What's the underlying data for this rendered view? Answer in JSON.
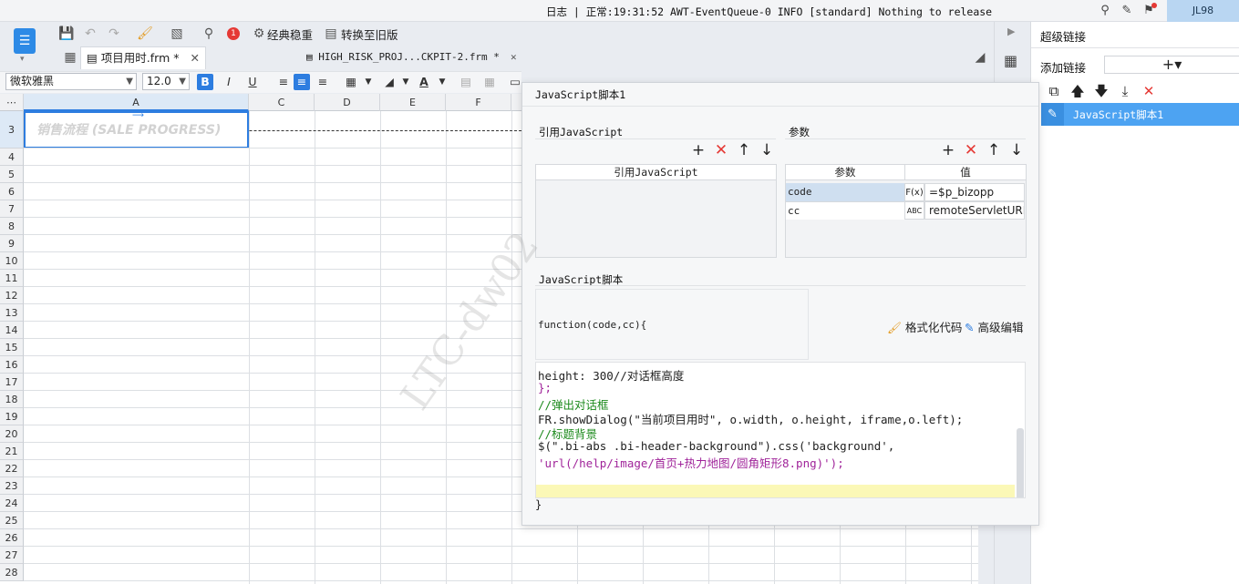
{
  "status_bar": {
    "log_text": "日志 | 正常:19:31:52 AWT-EventQueue-0 INFO [standard] Nothing to release",
    "user": "JL98"
  },
  "toolbar": {
    "notification_count": "1",
    "classic_stable_label": "经典稳重",
    "convert_old_label": "转换至旧版"
  },
  "tabs": [
    {
      "label": "项目用时.frm *",
      "active": true
    },
    {
      "label": "HIGH_RISK_PROJ...CKPIT-2.frm *",
      "active": false
    }
  ],
  "format": {
    "font_name": "微软雅黑",
    "font_size": "12.0",
    "bold": "B",
    "italic": "I",
    "underline": "U",
    "text_color": "A"
  },
  "grid": {
    "columns": [
      "A",
      "C",
      "D",
      "E",
      "F"
    ],
    "selected_row": "3",
    "rows": [
      "3",
      "4",
      "5",
      "6",
      "7",
      "8",
      "9",
      "10",
      "11",
      "12",
      "13",
      "14",
      "15",
      "16",
      "17",
      "18",
      "19",
      "20",
      "21",
      "22",
      "23",
      "24",
      "25",
      "26",
      "27",
      "28"
    ],
    "cell_a3": "销售流程 (SALE PROGRESS)"
  },
  "right_panel": {
    "title": "超级链接",
    "add_link_label": "添加链接",
    "add_button": "+▾",
    "items": [
      "JavaScript脚本1"
    ]
  },
  "dialog": {
    "title": "JavaScript脚本1",
    "ref_js_section": "引用JavaScript",
    "ref_js_column": "引用JavaScript",
    "params_section": "参数",
    "param_col": "参数",
    "value_col": "值",
    "params": [
      {
        "name": "code",
        "type_icon": "F(x)",
        "value": "=$p_bizopp"
      },
      {
        "name": "cc",
        "type_icon": "ABC",
        "value": "remoteServletURL"
      }
    ],
    "script_section": "JavaScript脚本",
    "function_sig": "function(code,cc){",
    "format_code": "格式化代码",
    "advanced_edit": "高级编辑",
    "code_lines": [
      "height: 300//对话框高度",
      "};",
      "//弹出对话框",
      "FR.showDialog(\"当前项目用时\", o.width, o.height, iframe,o.left);",
      "//标题背景",
      "$(\".bi-abs .bi-header-background\").css('background',",
      "'url(/help/image/首页+热力地图/圆角矩形8.png)');"
    ],
    "closing": "}"
  },
  "watermark": "LTC-dw02"
}
